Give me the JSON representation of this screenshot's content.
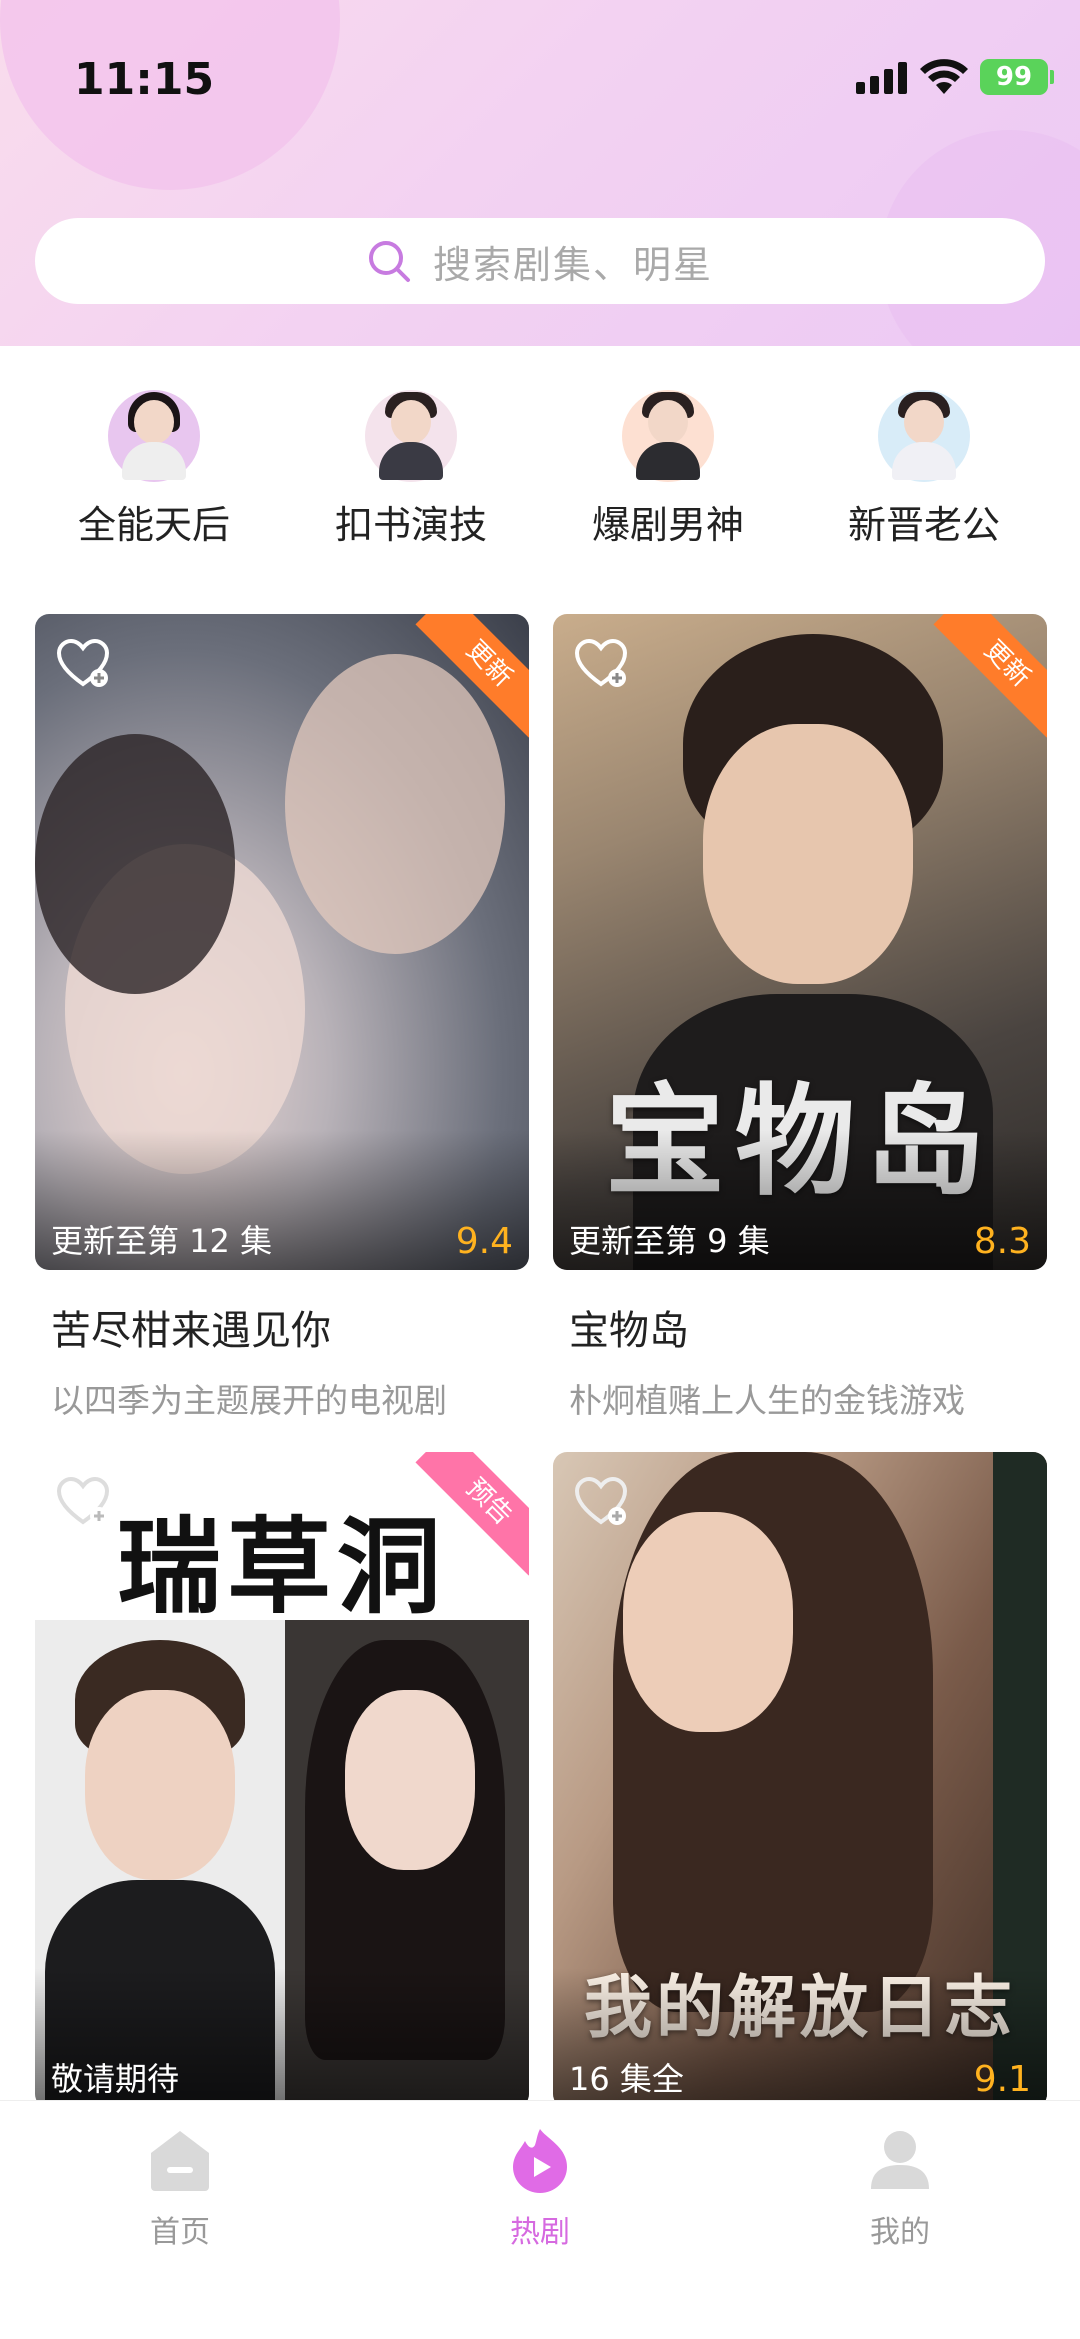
{
  "status_bar": {
    "time": "11:15",
    "battery": "99"
  },
  "search": {
    "placeholder": "搜索剧集、明星"
  },
  "categories": [
    {
      "label": "全能天后",
      "icon": "sparkle-female-avatar-icon"
    },
    {
      "label": "扣书演技",
      "icon": "phone-male-avatar-icon"
    },
    {
      "label": "爆剧男神",
      "icon": "fire-male-avatar-icon"
    },
    {
      "label": "新晋老公",
      "icon": "heart-male-avatar-icon"
    }
  ],
  "cards": [
    {
      "title": "苦尽柑来遇见你",
      "desc": "以四季为主题展开的电视剧",
      "episode": "更新至第 12 集",
      "score": "9.4",
      "ribbon": "更新",
      "poster_text": ""
    },
    {
      "title": "宝物岛",
      "desc": "朴炯植赌上人生的金钱游戏",
      "episode": "更新至第 9 集",
      "score": "8.3",
      "ribbon": "更新",
      "poster_text": "宝物岛"
    },
    {
      "title": "",
      "desc": "",
      "episode": "敬请期待",
      "score": "",
      "ribbon": "预告",
      "poster_text": "瑞草洞"
    },
    {
      "title": "",
      "desc": "",
      "episode": "16 集全",
      "score": "9.1",
      "ribbon": "",
      "poster_text": "我的解放日志"
    }
  ],
  "tabbar": [
    {
      "label": "首页",
      "icon": "home-icon",
      "active": false
    },
    {
      "label": "热剧",
      "icon": "hot-play-icon",
      "active": true
    },
    {
      "label": "我的",
      "icon": "profile-icon",
      "active": false
    }
  ],
  "colors": {
    "accent": "#d66ae0",
    "score": "#ffb21f",
    "ribbon_update": "#ff7c2a",
    "ribbon_preview": "#ff74a8"
  }
}
